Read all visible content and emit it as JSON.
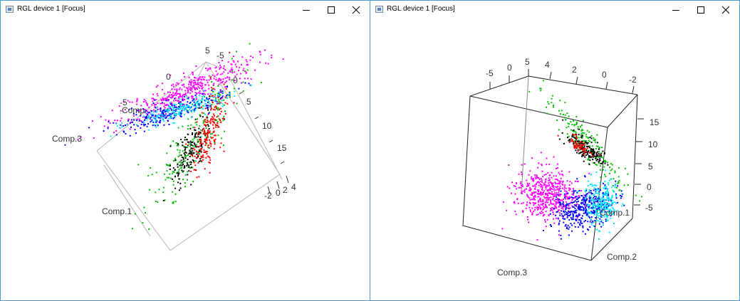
{
  "windows": [
    {
      "title": "RGL device 1 [Focus]",
      "axis_labels": {
        "comp1": "Comp.1",
        "comp2": "Comp",
        "comp3": "Comp.3"
      },
      "ticks_a": [
        "-5",
        "0",
        "5"
      ],
      "ticks_b": [
        "-5",
        "0",
        "5",
        "10",
        "15"
      ],
      "ticks_c": [
        "-2",
        "0",
        "2",
        "4"
      ],
      "ticks_d": [
        "5"
      ]
    },
    {
      "title": "RGL device 1 [Focus]",
      "axis_labels": {
        "comp1": "Comp.1",
        "comp2": "Comp.2",
        "comp3": "Comp.3"
      },
      "ticks_top_left": [
        "-5",
        "0",
        "5"
      ],
      "ticks_top_right": [
        "4",
        "2",
        "0",
        "-2"
      ],
      "ticks_right": [
        "15",
        "10",
        "5",
        "0",
        "-5"
      ]
    }
  ],
  "colors": {
    "magenta": "#ff00ff",
    "blue": "#0000ff",
    "cyan": "#00e5ff",
    "black": "#000000",
    "red": "#ff0000",
    "green": "#00c000",
    "window_border": "#4a9bd0"
  }
}
